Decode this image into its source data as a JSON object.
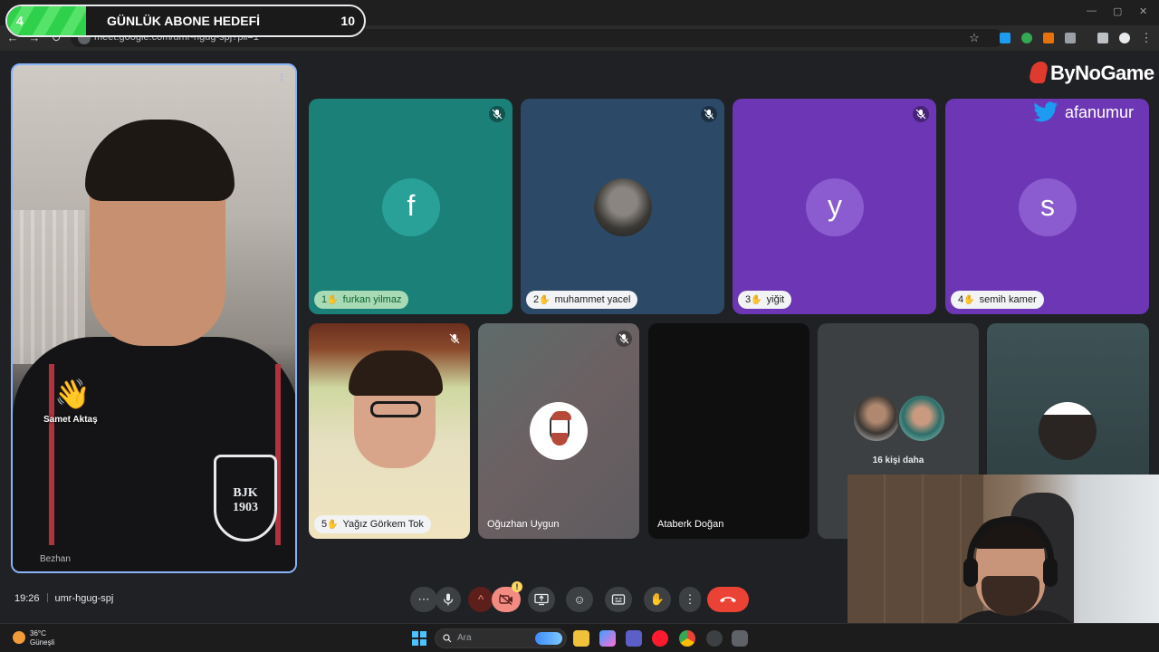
{
  "browser": {
    "url": "meet.google.com/umr-hgug-spj?pli=1"
  },
  "goal_bar": {
    "start": "4",
    "title": "GÜNLÜK ABONE HEDEFİ",
    "end": "10",
    "progress_fraction": 0.22,
    "fill_color": "#2fd14a"
  },
  "brand": {
    "name": "ByNoGame",
    "twitter_handle": "afanumur"
  },
  "self_tile": {
    "reaction_name": "Samet Aktaş",
    "name": "Bezhan",
    "border_color": "#8ab4f8"
  },
  "tiles": [
    {
      "order": "1",
      "name": "furkan yilmaz",
      "avatar": "f",
      "bg": "#1b8078",
      "avatar_bg": "#2aa198",
      "muted": true,
      "active": true
    },
    {
      "order": "2",
      "name": "muhammet yacel",
      "avatar": "",
      "bg": "#2c4a68",
      "muted": true,
      "active": false
    },
    {
      "order": "3",
      "name": "yiğit",
      "avatar": "y",
      "bg": "#6c36b5",
      "avatar_bg": "#8b5ccf",
      "muted": true,
      "active": false
    },
    {
      "order": "4",
      "name": "semih kamer",
      "avatar": "s",
      "bg": "#6c36b5",
      "avatar_bg": "#8b5ccf",
      "muted": false,
      "active": false
    }
  ],
  "row2": {
    "yagiz": {
      "order": "5",
      "name": "Yağız Görkem Tok"
    },
    "oguzhan": {
      "name": "Oğuzhan Uygun"
    },
    "ataberk": {
      "name": "Ataberk Doğan"
    },
    "more": {
      "label": "16 kişi daha"
    }
  },
  "meeting": {
    "time": "19:26",
    "code": "umr-hgug-spj"
  },
  "taskbar": {
    "temp": "36°C",
    "weather": "Güneşli",
    "search_placeholder": "Ara"
  },
  "colors": {
    "hangup": "#ea4335",
    "camera_off": "#f28b82",
    "accent": "#8ab4f8"
  }
}
